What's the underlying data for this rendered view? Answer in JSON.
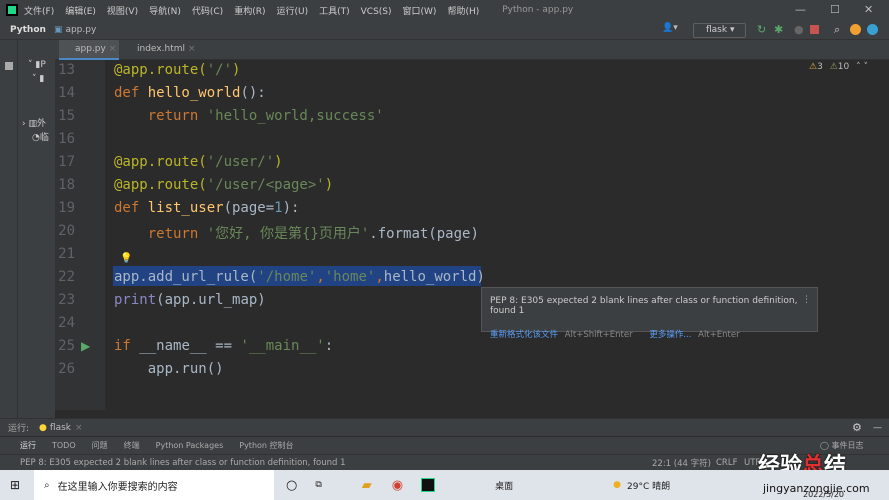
{
  "titlebar": {
    "menus": [
      "文件(F)",
      "编辑(E)",
      "视图(V)",
      "导航(N)",
      "代码(C)",
      "重构(R)",
      "运行(U)",
      "工具(T)",
      "VCS(S)",
      "窗口(W)",
      "帮助(H)"
    ],
    "title": "Python - app.py"
  },
  "navbar": {
    "project": "Python",
    "file": "app.py",
    "run_config": "flask"
  },
  "tabs": [
    {
      "label": "app.py",
      "active": true
    },
    {
      "label": "index.html",
      "active": false
    }
  ],
  "inspections": {
    "warnings": "3",
    "weak_warnings": "10"
  },
  "project_tree": [
    "P",
    "外",
    "临"
  ],
  "editor": {
    "lines": [
      {
        "n": "13",
        "tokens": [
          [
            "@app.route(",
            "#bbb529"
          ],
          [
            "'/'",
            "#6a8759"
          ],
          [
            ")",
            "#bbb529"
          ]
        ]
      },
      {
        "n": "14",
        "tokens": [
          [
            "def ",
            "#cc7832"
          ],
          [
            "hello_world",
            "#ffc66d"
          ],
          [
            "():",
            "#a9b7c6"
          ]
        ]
      },
      {
        "n": "15",
        "tokens": [
          [
            "    return ",
            "#cc7832"
          ],
          [
            "'hello_world,success'",
            "#6a8759"
          ]
        ]
      },
      {
        "n": "16",
        "tokens": []
      },
      {
        "n": "17",
        "tokens": [
          [
            "@app.route(",
            "#bbb529"
          ],
          [
            "'/user/'",
            "#6a8759"
          ],
          [
            ")",
            "#bbb529"
          ]
        ]
      },
      {
        "n": "18",
        "tokens": [
          [
            "@app.route(",
            "#bbb529"
          ],
          [
            "'/user/<page>'",
            "#6a8759"
          ],
          [
            ")",
            "#bbb529"
          ]
        ]
      },
      {
        "n": "19",
        "tokens": [
          [
            "def ",
            "#cc7832"
          ],
          [
            "list_user",
            "#ffc66d"
          ],
          [
            "(page=",
            "#a9b7c6"
          ],
          [
            "1",
            "#6897bb"
          ],
          [
            "):",
            "#a9b7c6"
          ]
        ]
      },
      {
        "n": "20",
        "tokens": [
          [
            "    return ",
            "#cc7832"
          ],
          [
            "'您好, 你是第{}页用户'",
            "#6a8759"
          ],
          [
            ".format(page)",
            "#a9b7c6"
          ]
        ]
      },
      {
        "n": "21",
        "tokens": []
      },
      {
        "n": "22",
        "tokens": [
          [
            "app.add_url_rule(",
            "#a9b7c6"
          ],
          [
            "'/home'",
            "#6a8759"
          ],
          [
            ",",
            "#cc7832"
          ],
          [
            "'home'",
            "#6a8759"
          ],
          [
            ",",
            "#cc7832"
          ],
          [
            "hello_world)",
            "#a9b7c6"
          ]
        ]
      },
      {
        "n": "23",
        "tokens": [
          [
            "print",
            "#8888c6"
          ],
          [
            "(app.url_map)",
            "#a9b7c6"
          ]
        ]
      },
      {
        "n": "24",
        "tokens": []
      },
      {
        "n": "25",
        "tokens": [
          [
            "if ",
            "#cc7832"
          ],
          [
            "__name__ == ",
            "#a9b7c6"
          ],
          [
            "'__main__'",
            "#6a8759"
          ],
          [
            ":",
            "#a9b7c6"
          ]
        ]
      },
      {
        "n": "26",
        "tokens": [
          [
            "    app.run()",
            "#a9b7c6"
          ]
        ]
      }
    ]
  },
  "tooltip": {
    "message": "PEP 8: E305 expected 2 blank lines after class or function definition, found 1",
    "action1": "重新格式化该文件",
    "shortcut1": "Alt+Shift+Enter",
    "action2": "更多操作...",
    "shortcut2": "Alt+Enter"
  },
  "runbar": {
    "label": "运行:",
    "config": "flask"
  },
  "bottom_tabs": [
    "运行",
    "TODO",
    "问题",
    "终端",
    "Python Packages",
    "Python 控制台"
  ],
  "event_log": "事件日志",
  "statusbar": {
    "message": "PEP 8: E305 expected 2 blank lines after class or function definition, found 1",
    "position": "22:1 (44 字符)",
    "line_sep": "CRLF",
    "encoding": "UTF"
  },
  "taskbar": {
    "search_placeholder": "在这里输入你要搜索的内容",
    "desktop": "桌面",
    "weather": "29°C 晴朗",
    "date": "2022/5/20"
  },
  "watermark": {
    "text": "经验总结",
    "url": "jingyanzongjie.com"
  }
}
